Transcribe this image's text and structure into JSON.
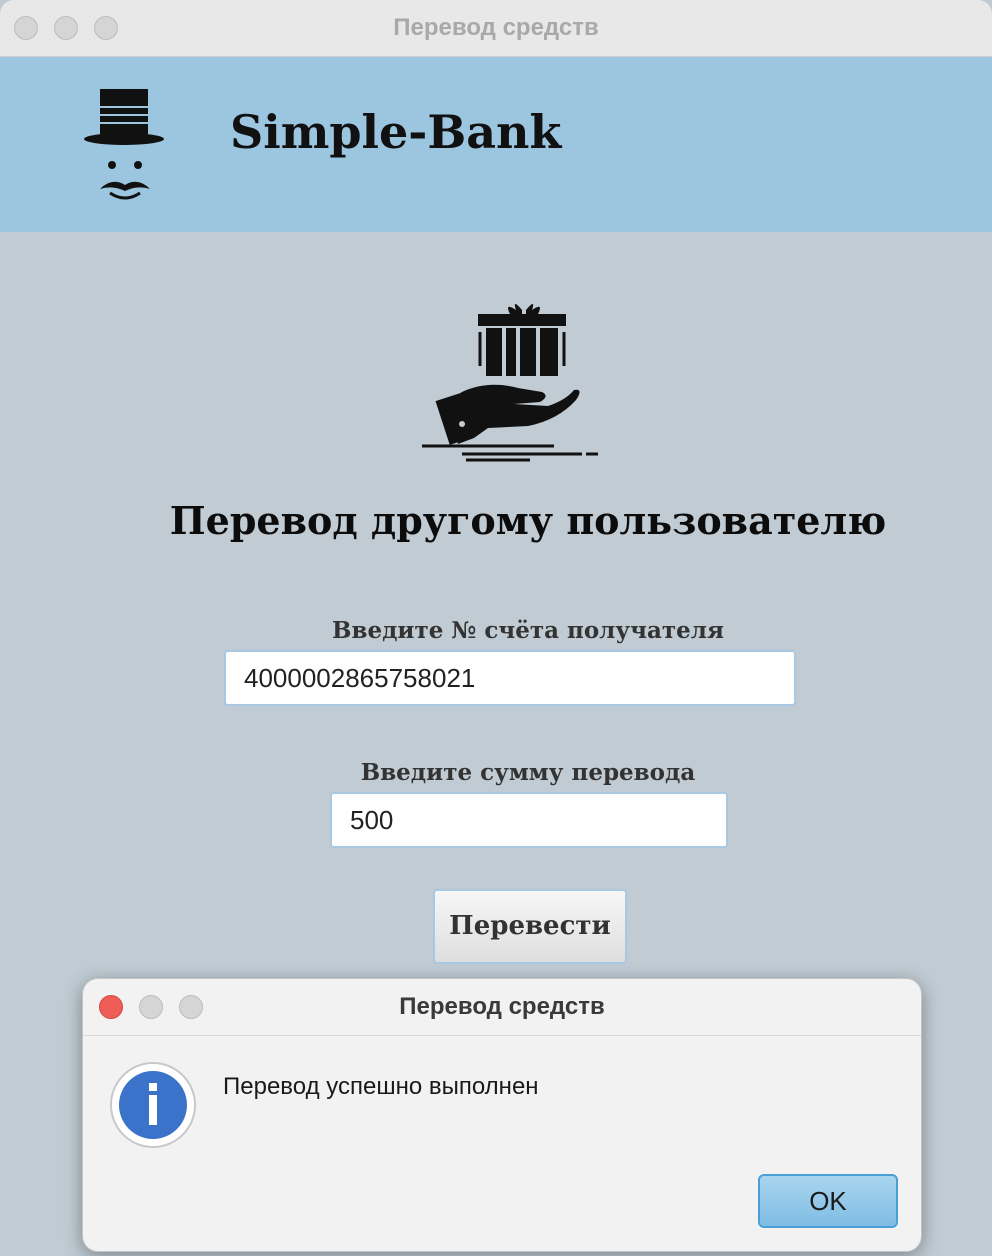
{
  "window": {
    "title": "Перевод средств"
  },
  "header": {
    "brand": "Simple-Bank",
    "logo_icon": "top-hat-mustache-logo"
  },
  "main": {
    "hero_icon": "gift-in-hand-icon",
    "title": "Перевод другому пользователю",
    "account_label": "Введите № счёта получателя",
    "account_value": "4000002865758021",
    "amount_label": "Введите сумму перевода",
    "amount_value": "500",
    "transfer_button": "Перевести"
  },
  "dialog": {
    "title": "Перевод средств",
    "icon": "info-icon",
    "message": "Перевод успешно выполнен",
    "ok_button": "OK"
  },
  "colors": {
    "header_bg": "#9cc5e0",
    "body_bg": "#c0cbd3",
    "close_red": "#ee5e57",
    "info_blue": "#3a73c9",
    "ok_button": "#8cc6e8"
  }
}
